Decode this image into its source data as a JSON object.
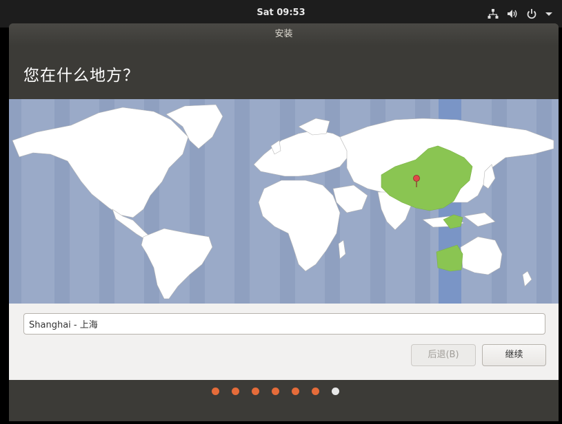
{
  "system_bar": {
    "clock": "Sat 09:53",
    "icons": [
      "network-icon",
      "volume-icon",
      "power-icon",
      "menu-arrow-icon"
    ]
  },
  "window": {
    "title": "安装",
    "heading": "您在什么地方？"
  },
  "map": {
    "selected_timezone_color": "#7a95c6",
    "selected_region_color": "#8ac552",
    "ocean_color": "#9aaac8",
    "land_color": "#ffffff",
    "pin_color": "#e04848"
  },
  "location": {
    "value": "Shanghai - 上海"
  },
  "buttons": {
    "back": "后退(B)",
    "continue": "继续"
  },
  "progress": {
    "total_steps": 7,
    "current_step": 7,
    "completed_color": "#e66c3a",
    "current_color": "#e8e8e8"
  }
}
